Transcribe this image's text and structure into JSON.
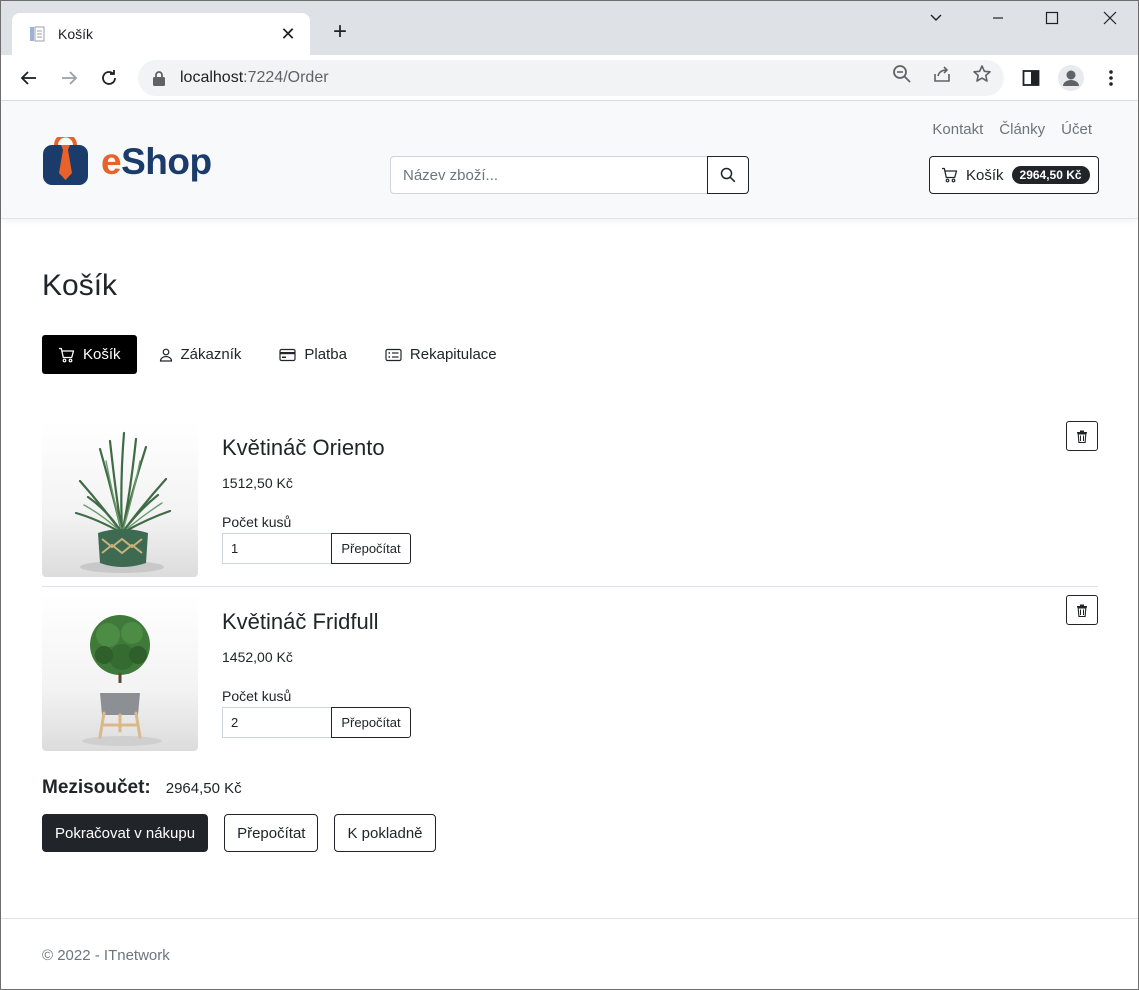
{
  "browser": {
    "tab_title": "Košík",
    "url_host": "localhost",
    "url_path": ":7224/Order"
  },
  "site": {
    "logo_e": "e",
    "logo_shop": "Shop",
    "top_links": [
      "Kontakt",
      "Články",
      "Účet"
    ],
    "search_placeholder": "Název zboží...",
    "cart_label": "Košík",
    "cart_total": "2964,50 Kč"
  },
  "page": {
    "title": "Košík",
    "steps": [
      {
        "label": "Košík",
        "active": true
      },
      {
        "label": "Zákazník",
        "active": false
      },
      {
        "label": "Platba",
        "active": false
      },
      {
        "label": "Rekapitulace",
        "active": false
      }
    ]
  },
  "items": [
    {
      "name": "Květináč Oriento",
      "price": "1512,50 Kč",
      "qty_label": "Počet kusů",
      "qty": "1",
      "recalc_label": "Přepočítat"
    },
    {
      "name": "Květináč Fridfull",
      "price": "1452,00 Kč",
      "qty_label": "Počet kusů",
      "qty": "2",
      "recalc_label": "Přepočítat"
    }
  ],
  "summary": {
    "subtotal_label": "Mezisoučet:",
    "subtotal_value": "2964,50 Kč",
    "continue_label": "Pokračovat v nákupu",
    "recalc_label": "Přepočítat",
    "checkout_label": "K pokladně"
  },
  "footer": {
    "text": "© 2022 - ITnetwork"
  }
}
